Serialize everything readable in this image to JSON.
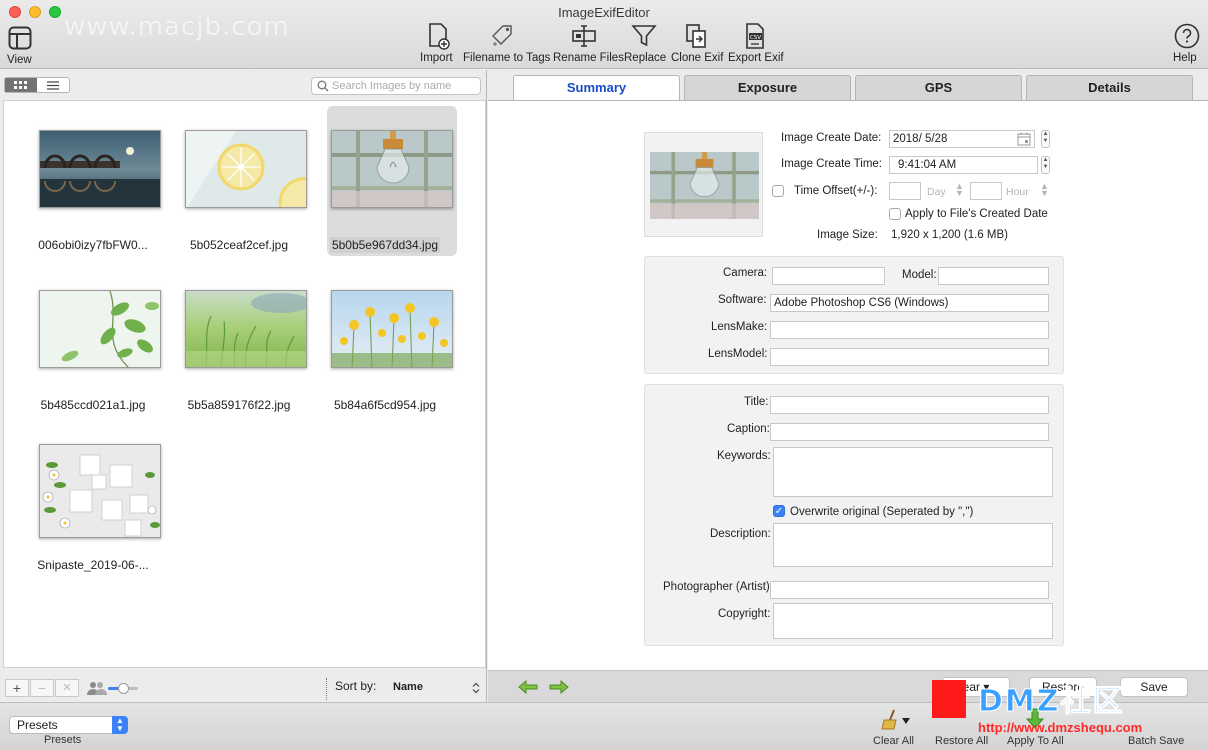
{
  "window": {
    "title": "ImageExifEditor",
    "watermark": "www.macjb.com"
  },
  "toolbar": {
    "view": "View",
    "import": "Import",
    "filename_to_tags": "Filename to Tags",
    "rename_files": "Rename Files",
    "replace": "Replace",
    "clone_exif": "Clone Exif",
    "export_exif": "Export Exif",
    "help": "Help"
  },
  "browser": {
    "search_placeholder": "Search Images by name",
    "images": [
      {
        "name": "006obi0izy7fbFW0...",
        "icon": "bridge-night-photo"
      },
      {
        "name": "5b052ceaf2cef.jpg",
        "icon": "lemon-photo"
      },
      {
        "name": "5b0b5e967dd34.jpg",
        "icon": "lightbulb-photo",
        "selected": true
      },
      {
        "name": "5b485ccd021a1.jpg",
        "icon": "green-leaves-photo"
      },
      {
        "name": "5b5a859176f22.jpg",
        "icon": "grass-photo"
      },
      {
        "name": "5b84a6f5cd954.jpg",
        "icon": "yellow-flowers-photo"
      },
      {
        "name": "Snipaste_2019-06-...",
        "icon": "floral-cubes-photo"
      }
    ],
    "sort_by_label": "Sort by:",
    "sort_by_value": "Name"
  },
  "tabs": {
    "summary": "Summary",
    "exposure": "Exposure",
    "gps": "GPS",
    "details": "Details"
  },
  "summary": {
    "create_date_label": "Image Create Date:",
    "create_date_value": "2018/  5/28",
    "create_time_label": "Image Create Time:",
    "create_time_value": "9:41:04 AM",
    "time_offset_label": "Time Offset(+/-):",
    "day_label": "Day",
    "hour_label": "Hour",
    "apply_created_date_label": "Apply to File's Created Date",
    "image_size_label": "Image Size:",
    "image_size_value": "1,920 x 1,200 (1.6 MB)",
    "camera_label": "Camera:",
    "camera_value": "",
    "model_label": "Model:",
    "model_value": "",
    "software_label": "Software:",
    "software_value": "Adobe Photoshop CS6 (Windows)",
    "lensmake_label": "LensMake:",
    "lensmake_value": "",
    "lensmodel_label": "LensModel:",
    "lensmodel_value": "",
    "title_label": "Title:",
    "title_value": "",
    "caption_label": "Caption:",
    "caption_value": "",
    "keywords_label": "Keywords:",
    "overwrite_label": "Overwrite original (Seperated by \",\")",
    "description_label": "Description:",
    "photographer_label": "Photographer (Artist):",
    "photographer_value": "",
    "copyright_label": "Copyright:"
  },
  "right_bottom": {
    "clear_partial": "ear",
    "restore": "Restore",
    "save": "Save"
  },
  "bottombar": {
    "presets_select": "Presets",
    "presets_label": "Presets",
    "clear_all": "Clear All",
    "restore_all": "Restore All",
    "apply_to_all": "Apply To All",
    "batch_save": "Batch Save"
  },
  "overlay": {
    "brand_text": "DMZ社区",
    "url": "http://www.dmzshequ.com"
  },
  "colors": {
    "accent": "#3b82f6",
    "active_tab_text": "#1a4cc8",
    "overlay_red": "#ff1a1a"
  }
}
